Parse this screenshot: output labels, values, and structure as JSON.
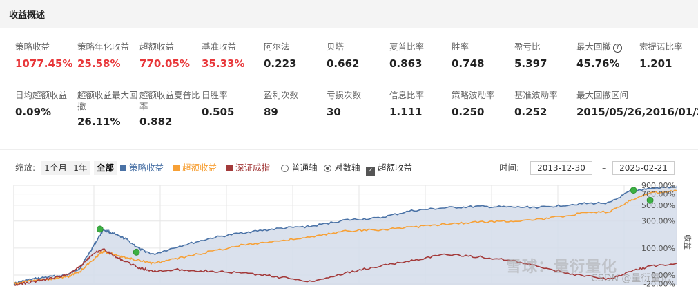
{
  "header": {
    "title": "收益概述"
  },
  "stats_row1": [
    {
      "label": "策略收益",
      "value": "1077.45%",
      "red": true
    },
    {
      "label": "策略年化收益",
      "value": "25.58%",
      "red": true
    },
    {
      "label": "超额收益",
      "value": "770.05%",
      "red": true
    },
    {
      "label": "基准收益",
      "value": "35.33%",
      "red": true
    },
    {
      "label": "阿尔法",
      "value": "0.223"
    },
    {
      "label": "贝塔",
      "value": "0.662"
    },
    {
      "label": "夏普比率",
      "value": "0.863"
    },
    {
      "label": "胜率",
      "value": "0.748"
    },
    {
      "label": "盈亏比",
      "value": "5.397"
    },
    {
      "label": "最大回撤",
      "value": "45.76%",
      "help_icon": "question-circle-icon"
    },
    {
      "label": "索提诺比率",
      "value": "1.201"
    }
  ],
  "stats_row2": [
    {
      "label": "日均超额收益",
      "value": "0.09%"
    },
    {
      "label": "超额收益最大回撤",
      "value": "26.11%"
    },
    {
      "label": "超额收益夏普比率",
      "value": "0.882"
    },
    {
      "label": "日胜率",
      "value": "0.505"
    },
    {
      "label": "盈利次数",
      "value": "89"
    },
    {
      "label": "亏损次数",
      "value": "30"
    },
    {
      "label": "信息比率",
      "value": "1.111"
    },
    {
      "label": "策略波动率",
      "value": "0.250"
    },
    {
      "label": "基准波动率",
      "value": "0.252"
    },
    {
      "label": "最大回撤区间",
      "value": "2015/05/26,2016/01/2"
    }
  ],
  "toolbar": {
    "zoom_label": "缩放:",
    "zoom_buttons": [
      "1个月",
      "1年",
      "全部"
    ],
    "active_zoom": "全部",
    "legend": [
      {
        "name": "策略收益",
        "color": "#4a72a6"
      },
      {
        "name": "超额收益",
        "color": "#f7a035"
      },
      {
        "name": "深证成指",
        "color": "#a33a3a"
      }
    ],
    "axis_options": [
      "普通轴",
      "对数轴"
    ],
    "selected_axis": "对数轴",
    "checkbox_label": "超额收益",
    "checkbox_checked": true,
    "time_label": "时间:",
    "date_from": "2013-12-30",
    "date_separator": "–",
    "date_to": "2025-02-21"
  },
  "watermark": {
    "main": "雪球：量衍量化",
    "sub": "CSDN @量衍量化"
  },
  "chart_data": {
    "type": "line",
    "ylabel": "收益",
    "log_scale": true,
    "yticks": [
      "900.00%",
      "700.00%",
      "500.00%",
      "300.00%",
      "100.00%",
      "0.00%",
      "-20.00%"
    ],
    "ytick_values": [
      900,
      700,
      500,
      300,
      100,
      0,
      -20
    ],
    "x_range": [
      "2013-12-30",
      "2025-02-21"
    ],
    "grid": true,
    "series": [
      {
        "name": "策略收益",
        "color": "#4a72a6",
        "filled": true,
        "x": [
          0,
          0.02,
          0.05,
          0.08,
          0.1,
          0.12,
          0.135,
          0.15,
          0.17,
          0.19,
          0.21,
          0.25,
          0.3,
          0.35,
          0.4,
          0.45,
          0.5,
          0.55,
          0.6,
          0.65,
          0.7,
          0.75,
          0.8,
          0.85,
          0.9,
          0.93,
          0.96,
          1.0
        ],
        "y": [
          -20,
          -12,
          -5,
          0,
          20,
          110,
          220,
          190,
          150,
          95,
          70,
          110,
          160,
          200,
          230,
          250,
          310,
          330,
          420,
          460,
          480,
          470,
          470,
          520,
          540,
          760,
          820,
          860
        ]
      },
      {
        "name": "超额收益",
        "color": "#f7a035",
        "x": [
          0,
          0.02,
          0.05,
          0.08,
          0.1,
          0.12,
          0.135,
          0.15,
          0.17,
          0.19,
          0.21,
          0.25,
          0.3,
          0.35,
          0.4,
          0.45,
          0.5,
          0.55,
          0.6,
          0.65,
          0.7,
          0.75,
          0.8,
          0.85,
          0.9,
          0.93,
          0.96,
          1.0
        ],
        "y": [
          -20,
          -15,
          -10,
          -5,
          10,
          50,
          85,
          70,
          55,
          45,
          35,
          55,
          85,
          120,
          140,
          165,
          210,
          220,
          240,
          270,
          290,
          300,
          320,
          380,
          410,
          580,
          720,
          770
        ]
      },
      {
        "name": "深证成指",
        "color": "#a33a3a",
        "x": [
          0,
          0.02,
          0.05,
          0.08,
          0.1,
          0.12,
          0.135,
          0.15,
          0.17,
          0.19,
          0.21,
          0.25,
          0.3,
          0.35,
          0.4,
          0.45,
          0.5,
          0.55,
          0.6,
          0.65,
          0.7,
          0.75,
          0.8,
          0.85,
          0.9,
          0.93,
          0.96,
          1.0
        ],
        "y": [
          -22,
          -18,
          -10,
          0,
          25,
          75,
          95,
          65,
          40,
          20,
          10,
          15,
          10,
          5,
          -5,
          -15,
          5,
          25,
          45,
          70,
          60,
          45,
          20,
          0,
          -10,
          10,
          25,
          35
        ]
      }
    ],
    "markers": [
      {
        "series": "策略收益",
        "x": 0.13,
        "y": 225,
        "color": "#3cb043"
      },
      {
        "series": "策略收益",
        "x": 0.185,
        "y": 80,
        "color": "#3cb043"
      },
      {
        "series": "策略收益",
        "x": 0.935,
        "y": 780,
        "color": "#3cb043"
      },
      {
        "series": "策略收益",
        "x": 0.96,
        "y": 580,
        "color": "#3cb043"
      }
    ]
  }
}
